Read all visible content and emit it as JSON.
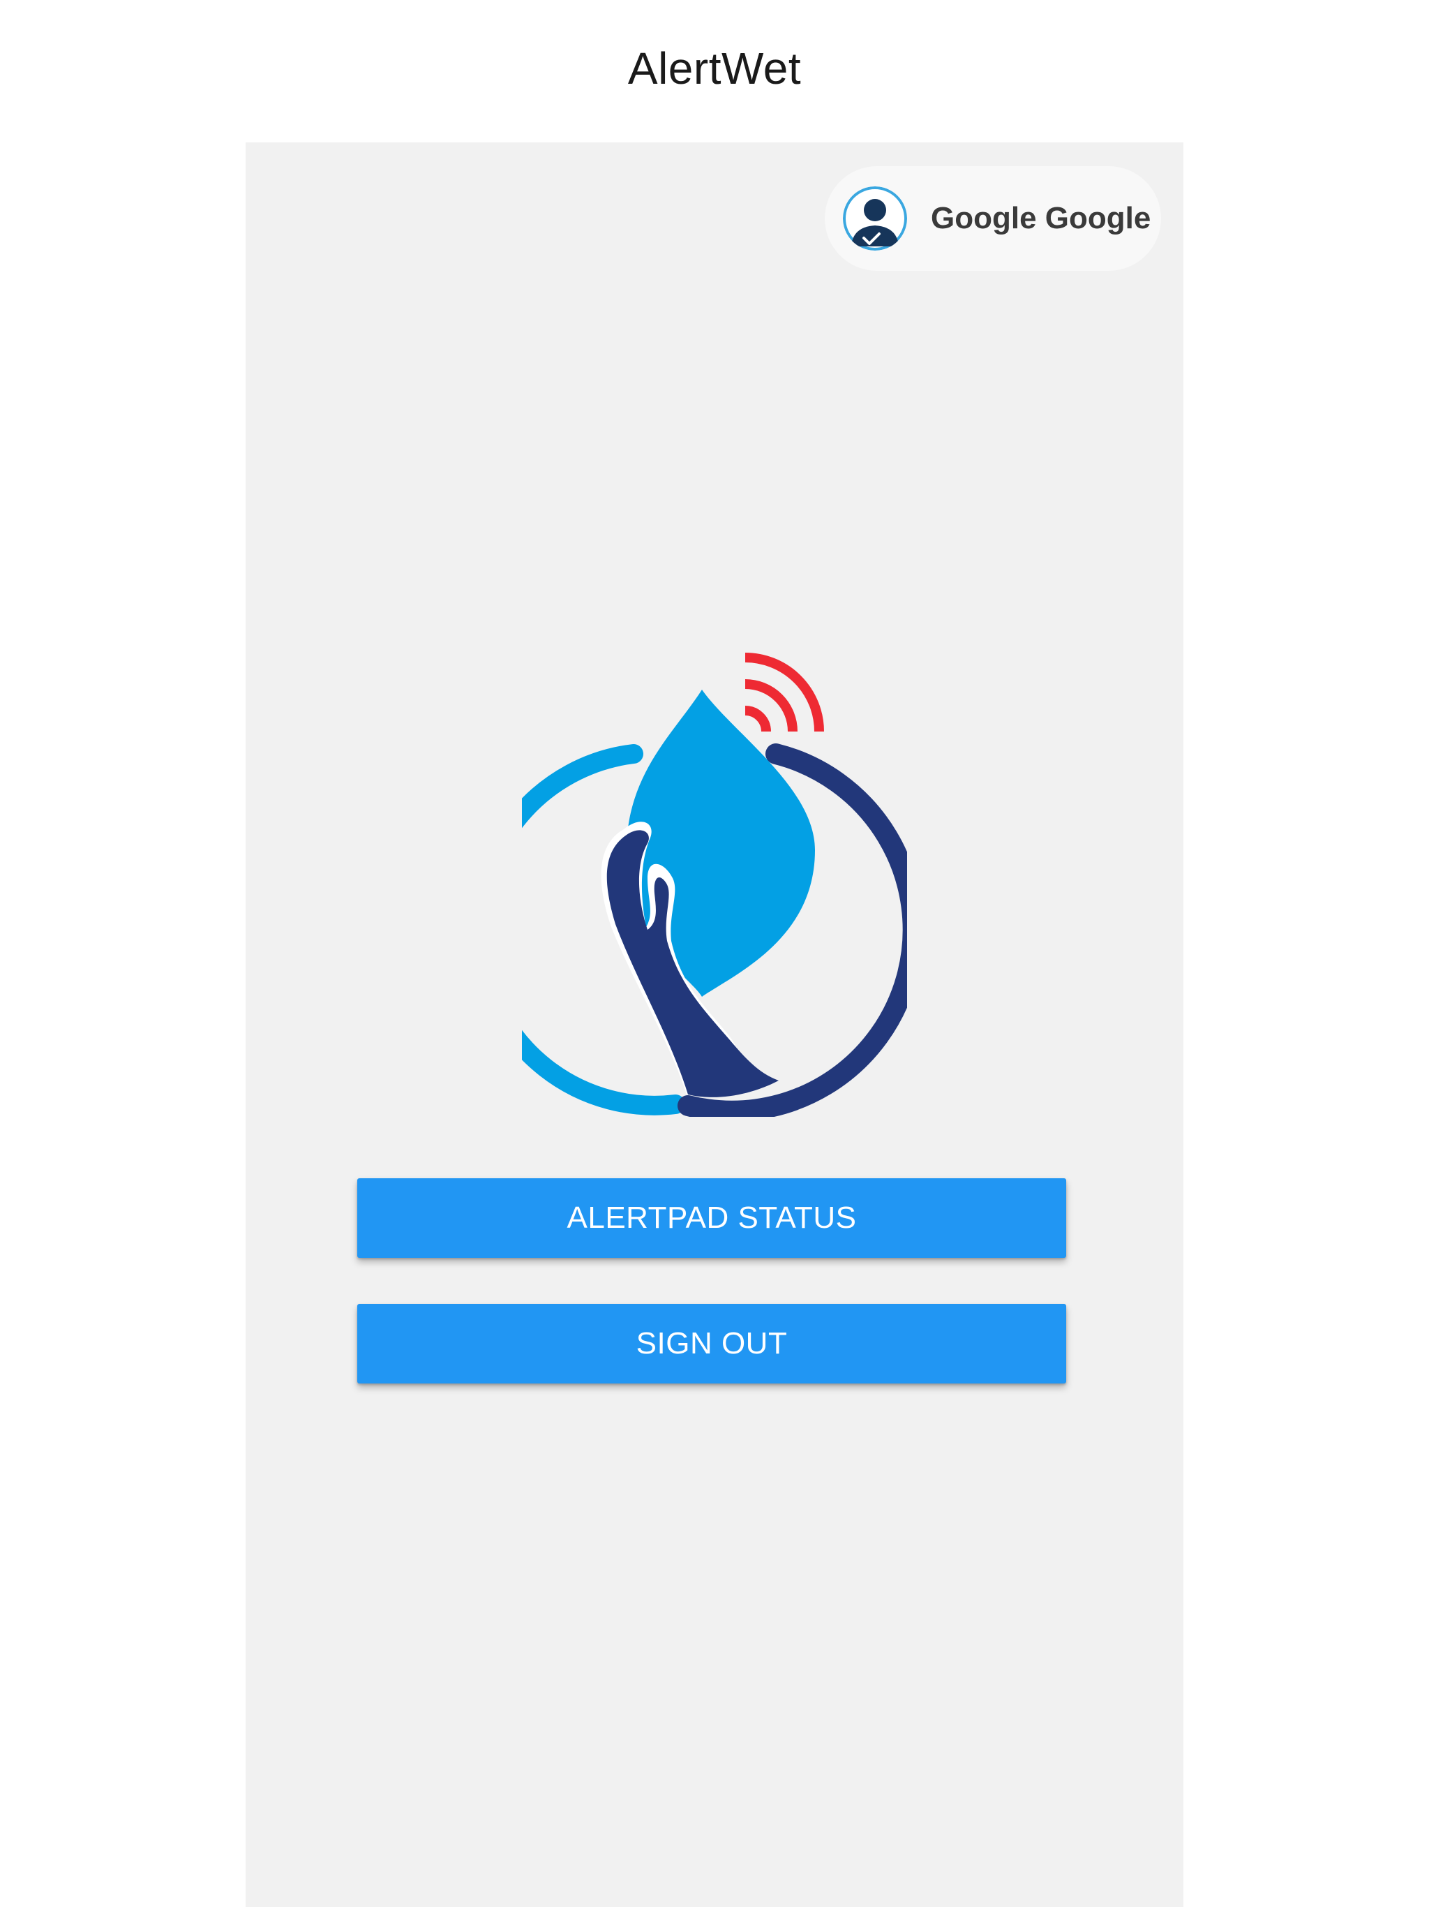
{
  "app": {
    "title": "AlertWet"
  },
  "user": {
    "name": "Google Google",
    "avatar_icon": "user-avatar-icon"
  },
  "logo": {
    "icon": "water-drop-hand-alert-logo",
    "colors": {
      "drop": "#03a0e4",
      "ring_light": "#03a0e4",
      "ring_dark": "#22377a",
      "hand": "#22377a",
      "signal": "#ee2a33"
    }
  },
  "actions": {
    "alertpad_status_label": "ALERTPAD STATUS",
    "sign_out_label": "SIGN OUT"
  },
  "colors": {
    "accent": "#2196f3",
    "background": "#f1f1f1"
  }
}
